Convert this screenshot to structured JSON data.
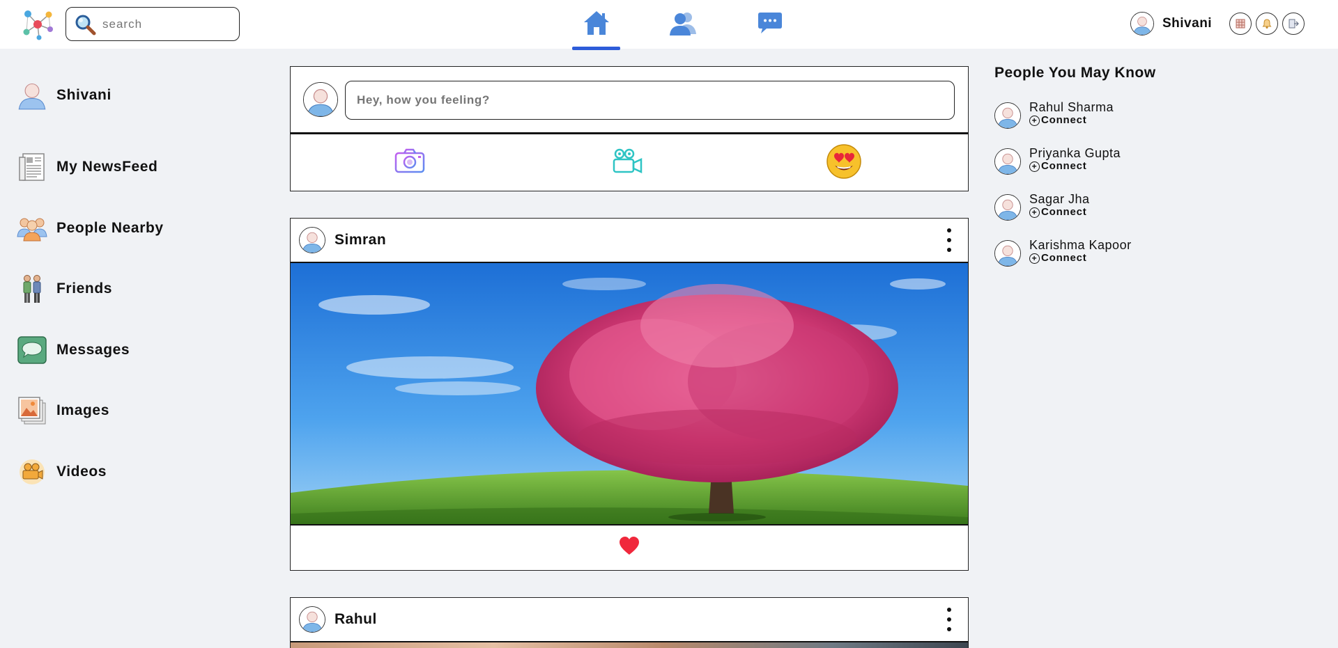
{
  "header": {
    "search": {
      "placeholder": "search"
    },
    "nav": [
      "home-icon",
      "friends-icon",
      "messages-icon"
    ],
    "active_nav": "home",
    "user": {
      "name": "Shivani"
    },
    "action_icons": [
      "apps-icon",
      "bell-icon",
      "logout-icon"
    ]
  },
  "sidebar": {
    "profile": {
      "name": "Shivani"
    },
    "items": [
      {
        "label": "My NewsFeed",
        "icon": "newspaper-icon"
      },
      {
        "label": "People Nearby",
        "icon": "people-nearby-icon"
      },
      {
        "label": "Friends",
        "icon": "friends-icon"
      },
      {
        "label": "Messages",
        "icon": "chat-bubble-icon"
      },
      {
        "label": "Images",
        "icon": "images-icon"
      },
      {
        "label": "Videos",
        "icon": "video-camera-icon"
      }
    ]
  },
  "composer": {
    "placeholder": "Hey, how you feeling?",
    "actions": [
      "camera-icon",
      "video-camera-icon",
      "heart-eyes-emoji-icon"
    ]
  },
  "posts": [
    {
      "author": "Simran",
      "image": "pink blossom tree on green hill under blue sky",
      "reaction": "heart-icon"
    },
    {
      "author": "Rahul"
    }
  ],
  "suggestions": {
    "title": "People You May Know",
    "connect_label": "Connect",
    "people": [
      {
        "name": "Rahul Sharma"
      },
      {
        "name": "Priyanka Gupta"
      },
      {
        "name": "Sagar Jha"
      },
      {
        "name": "Karishma Kapoor"
      }
    ]
  },
  "colors": {
    "accent": "#2d5cd9",
    "nav_icon": "#4a86d9",
    "background": "#f0f2f5",
    "heart": "#f0283c"
  }
}
